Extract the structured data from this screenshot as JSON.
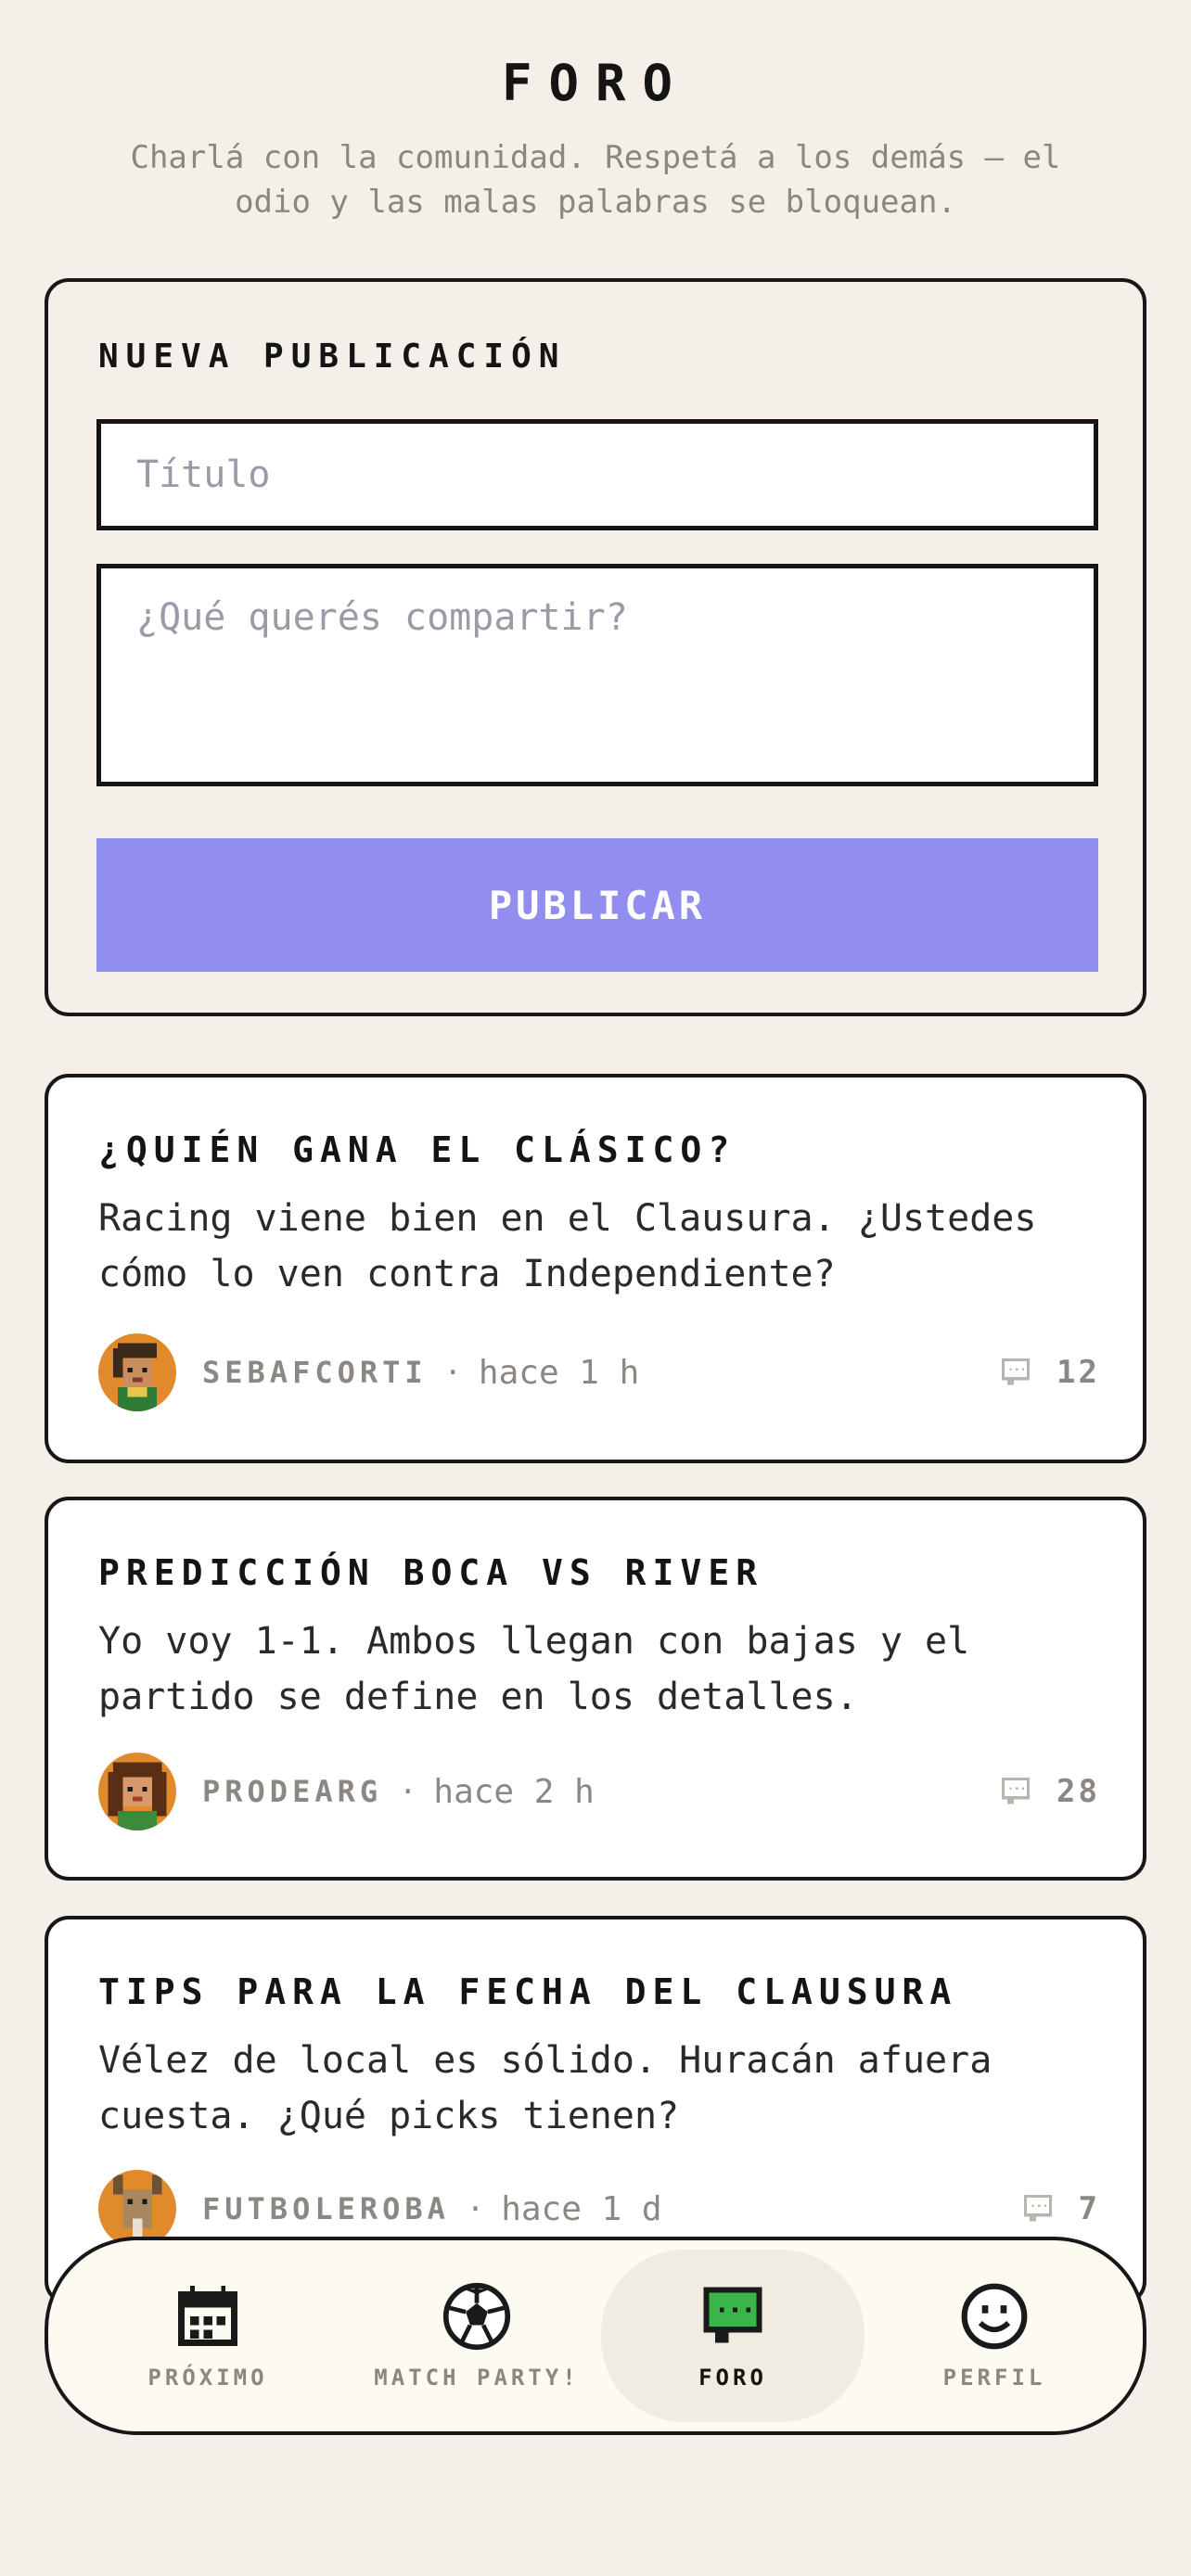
{
  "header": {
    "title": "FORO",
    "subtitle": "Charlá con la comunidad. Respetá a los demás — el odio y las malas palabras se bloquean."
  },
  "composer": {
    "heading": "NUEVA PUBLICACIÓN",
    "title_placeholder": "Título",
    "title_value": "",
    "body_placeholder": "¿Qué querés compartir?",
    "body_value": "",
    "publish_label": "PUBLICAR",
    "publish_color": "#928ef0"
  },
  "posts": [
    {
      "title": "¿QUIÉN GANA EL CLÁSICO?",
      "body": "Racing viene bien en el Clausura. ¿Ustedes cómo lo ven contra Independiente?",
      "author": "SEBAFCORTI",
      "separator": "·",
      "time": "hace 1 h",
      "comments": "12",
      "avatar_icon": "pixel-avatar-man-icon"
    },
    {
      "title": "PREDICCIÓN BOCA VS RIVER",
      "body": "Yo voy 1-1. Ambos llegan con bajas y el partido se define en los detalles.",
      "author": "PRODEARG",
      "separator": "·",
      "time": "hace 2 h",
      "comments": "28",
      "avatar_icon": "pixel-avatar-woman-icon"
    },
    {
      "title": "TIPS PARA LA FECHA DEL CLAUSURA",
      "body": "Vélez de local es sólido. Huracán afuera cuesta. ¿Qué picks tienen?",
      "author": "FUTBOLEROBA",
      "separator": "·",
      "time": "hace 1 d",
      "comments": "7",
      "avatar_icon": "pixel-avatar-goat-icon"
    }
  ],
  "nav": {
    "items": [
      {
        "label": "PRÓXIMO",
        "icon": "calendar-icon",
        "active": false
      },
      {
        "label": "MATCH PARTY!",
        "icon": "soccer-ball-icon",
        "active": false
      },
      {
        "label": "FORO",
        "icon": "chat-bubble-icon",
        "active": true
      },
      {
        "label": "PERFIL",
        "icon": "smiley-icon",
        "active": false
      }
    ]
  }
}
